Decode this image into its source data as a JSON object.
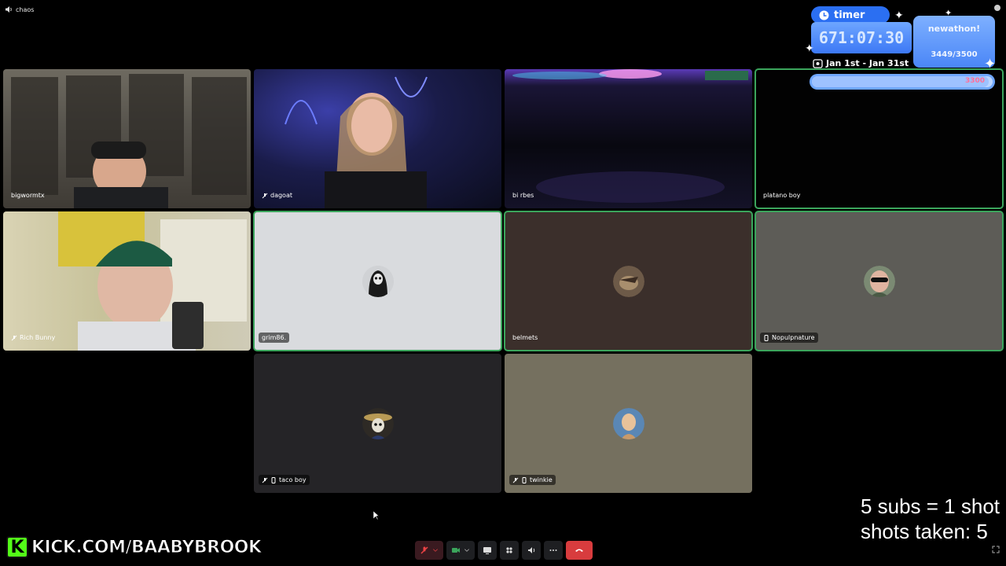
{
  "window": {
    "title": "chaos"
  },
  "tiles": [
    {
      "name": "bigwormtx",
      "kind": "video",
      "cls": "v-bigworm"
    },
    {
      "name": "dagoat",
      "kind": "video",
      "cls": "v-dagoat"
    },
    {
      "name": "bi rbes",
      "kind": "video",
      "cls": "v-birbes"
    },
    {
      "name": "platano boy",
      "kind": "video",
      "cls": "v-platano"
    },
    {
      "name": "Rich Bunny",
      "kind": "video",
      "cls": "v-rich"
    },
    {
      "name": "grim86.",
      "kind": "avatar",
      "bg": "#d9dbde"
    },
    {
      "name": "belmets",
      "kind": "avatar",
      "bg": "#3b2f2b"
    },
    {
      "name": "Nopulpnature",
      "kind": "avatar",
      "bg": "#5d5c57"
    },
    {
      "name": "taco boy",
      "kind": "avatar",
      "bg": "#252427"
    },
    {
      "name": "twinkie",
      "kind": "avatar",
      "bg": "#75705f"
    }
  ],
  "overlay": {
    "kick_logo": "K",
    "kick_url": "KICK.COM/BAABYBROOK",
    "subs_rule": "5 subs = 1 shot",
    "shots_taken": "shots taken: 5",
    "timer_label": "timer",
    "timer_value": "671:07:30",
    "newathon_title": "newathon!",
    "newathon_count": "3449/3500",
    "date_range": "Jan 1st - Jan 31st",
    "goal_value": "3300",
    "goal_progress": 0.98
  },
  "colors": {
    "speaking": "#3ba55c",
    "hangup": "#d83c3e",
    "kick": "#53fc18",
    "timer_blue": "#2b6ff2"
  }
}
